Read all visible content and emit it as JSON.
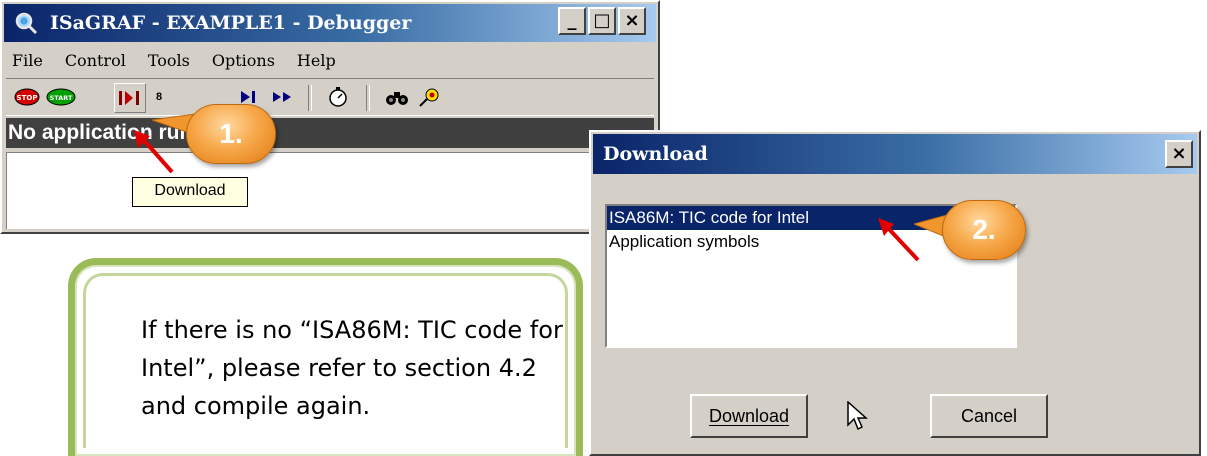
{
  "debugger": {
    "title": "ISaGRAF - EXAMPLE1 - Debugger",
    "controls": {
      "minimize": "_",
      "maximize": "□",
      "close": "×"
    },
    "menu": [
      "File",
      "Control",
      "Tools",
      "Options",
      "Help"
    ],
    "toolbar": {
      "stop": "STOP",
      "start": "START",
      "download_tooltip": "Download"
    },
    "status": "No application running"
  },
  "callouts": {
    "step1": "1.",
    "step2": "2."
  },
  "download_dialog": {
    "title": "Download",
    "close": "×",
    "items": [
      "ISA86M: TIC code for Intel",
      "Application symbols"
    ],
    "selected_index": 0,
    "download_button": "Download",
    "cancel_button": "Cancel"
  },
  "note": "If there is no “ISA86M: TIC code for Intel”, please refer to section 4.2 and compile again.",
  "colors": {
    "accent_orange": "#f0962c",
    "note_border": "#9bbb59",
    "title_blue": "#0a246a"
  }
}
